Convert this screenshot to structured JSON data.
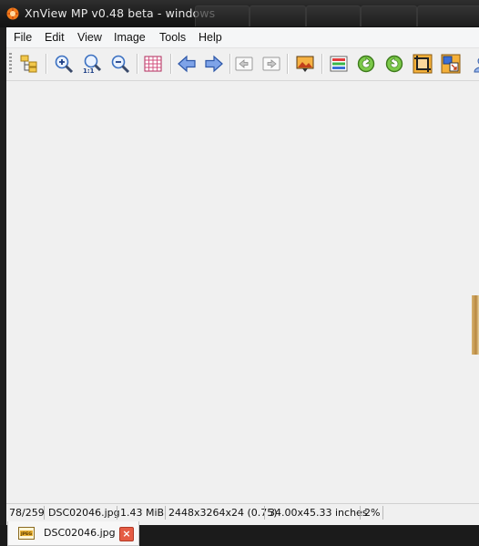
{
  "window": {
    "title": "XnView MP v0.48 beta - windows"
  },
  "menu": [
    "File",
    "Edit",
    "View",
    "Image",
    "Tools",
    "Help"
  ],
  "toolbar_icons": [
    "browser-icon",
    "zoom-in-icon",
    "zoom-actual-size-icon",
    "zoom-out-icon",
    "grid-icon",
    "previous-icon",
    "next-icon",
    "first-page-icon",
    "last-page-icon",
    "slideshow-icon",
    "adjust-colors-icon",
    "rotate-left-icon",
    "rotate-right-icon",
    "crop-icon",
    "resize-icon",
    "more-icon"
  ],
  "status": {
    "position": "78/259",
    "filename": "DSC02046.jpg",
    "filesize": "1.43 MiB",
    "dimensions": "2448x3264x24 (0.75)",
    "print_size": "34.00x45.33 inches",
    "zoom": "2%"
  },
  "tab": {
    "label": "DSC02046.jpg",
    "close": "×"
  },
  "colors": {
    "accent": "#3c6ec9",
    "close": "#e55c44"
  }
}
